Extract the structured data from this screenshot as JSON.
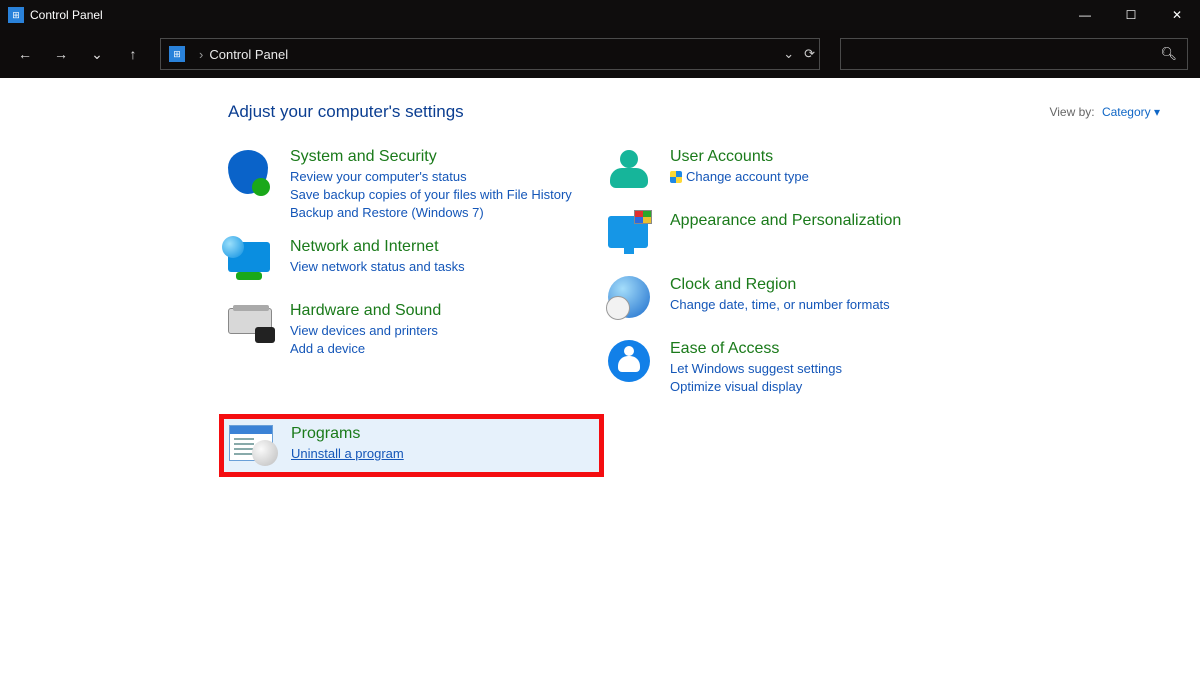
{
  "window": {
    "title": "Control Panel"
  },
  "address_bar": {
    "location": "Control Panel"
  },
  "heading": "Adjust your computer's settings",
  "view_by": {
    "label": "View by:",
    "value": "Category"
  },
  "left": {
    "system": {
      "title": "System and Security",
      "l1": "Review your computer's status",
      "l2": "Save backup copies of your files with File History",
      "l3": "Backup and Restore (Windows 7)"
    },
    "network": {
      "title": "Network and Internet",
      "l1": "View network status and tasks"
    },
    "hardware": {
      "title": "Hardware and Sound",
      "l1": "View devices and printers",
      "l2": "Add a device"
    },
    "programs": {
      "title": "Programs",
      "l1": "Uninstall a program"
    }
  },
  "right": {
    "users": {
      "title": "User Accounts",
      "l1": "Change account type"
    },
    "appearance": {
      "title": "Appearance and Personalization"
    },
    "clock": {
      "title": "Clock and Region",
      "l1": "Change date, time, or number formats"
    },
    "ease": {
      "title": "Ease of Access",
      "l1": "Let Windows suggest settings",
      "l2": "Optimize visual display"
    }
  }
}
